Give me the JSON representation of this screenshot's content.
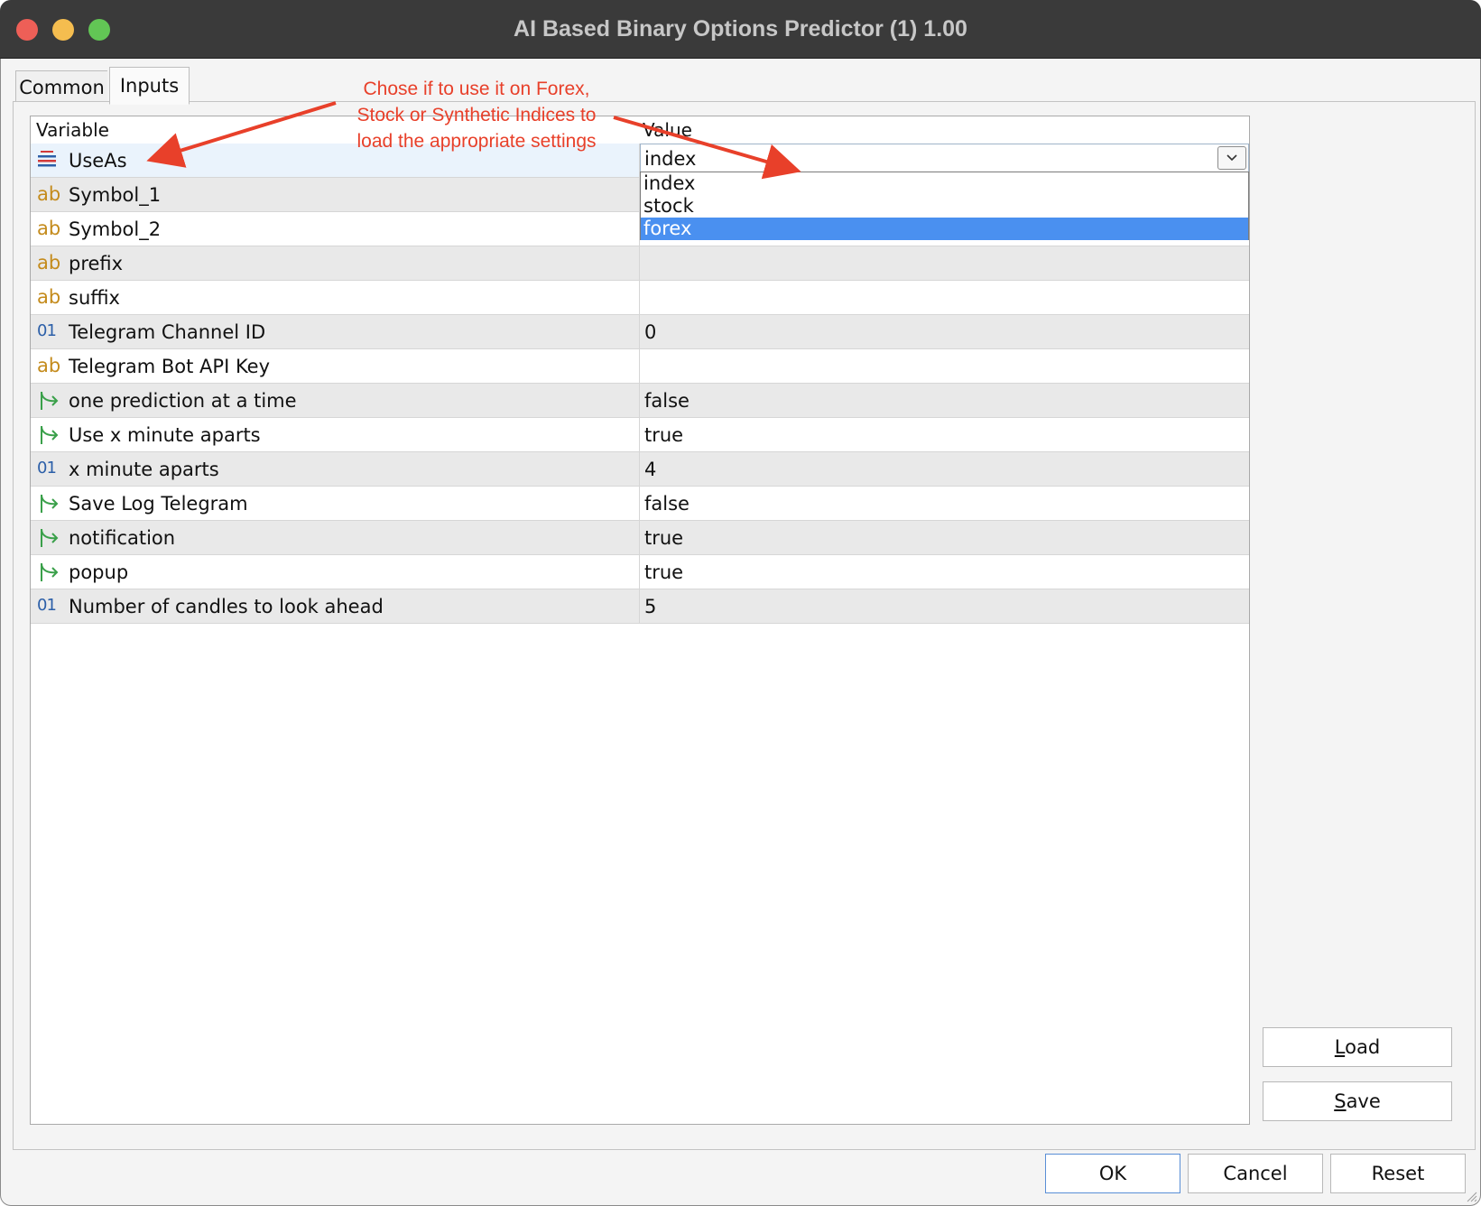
{
  "window": {
    "title": "AI Based Binary Options Predictor (1) 1.00"
  },
  "tabs": [
    {
      "label": "Common"
    },
    {
      "label": "Inputs"
    }
  ],
  "grid": {
    "headers": {
      "variable": "Variable",
      "value": "Value"
    },
    "rows": [
      {
        "name": "UseAs",
        "value": "index",
        "icon": "enum-icon"
      },
      {
        "name": "Symbol_1",
        "value": "",
        "icon": "string-icon"
      },
      {
        "name": "Symbol_2",
        "value": "",
        "icon": "string-icon"
      },
      {
        "name": "prefix",
        "value": "",
        "icon": "string-icon"
      },
      {
        "name": "suffix",
        "value": "",
        "icon": "string-icon"
      },
      {
        "name": "Telegram Channel ID",
        "value": "0",
        "icon": "integer-icon"
      },
      {
        "name": "Telegram Bot API Key",
        "value": "",
        "icon": "string-icon"
      },
      {
        "name": "one prediction at a time",
        "value": "false",
        "icon": "bool-icon"
      },
      {
        "name": "Use x minute aparts",
        "value": "true",
        "icon": "bool-icon"
      },
      {
        "name": "x minute aparts",
        "value": "4",
        "icon": "integer-icon"
      },
      {
        "name": "Save Log Telegram",
        "value": "false",
        "icon": "bool-icon"
      },
      {
        "name": "notification",
        "value": "true",
        "icon": "bool-icon"
      },
      {
        "name": "popup",
        "value": "true",
        "icon": "bool-icon"
      },
      {
        "name": "Number of candles to look ahead",
        "value": "5",
        "icon": "integer-icon"
      }
    ]
  },
  "dropdown": {
    "options": [
      "index",
      "stock",
      "forex"
    ],
    "highlighted": "forex"
  },
  "icons": {
    "string_glyph": "ab",
    "integer_glyph": "01"
  },
  "side_buttons": {
    "load": {
      "underlined": "L",
      "rest": "oad"
    },
    "save": {
      "underlined": "S",
      "rest": "ave"
    }
  },
  "footer": {
    "ok": "OK",
    "cancel": "Cancel",
    "reset": "Reset"
  },
  "annotation": {
    "lines": [
      "Chose if to use it on Forex,",
      "Stock or Synthetic Indices to",
      "load the appropriate settings"
    ],
    "color": "#e8402a"
  },
  "colors": {
    "titlebar": "#3a3a3a",
    "highlight": "#4a90f0",
    "string_icon": "#c48b1c",
    "integer_icon": "#2c5fa8",
    "bool_icon": "#3aa04a"
  }
}
